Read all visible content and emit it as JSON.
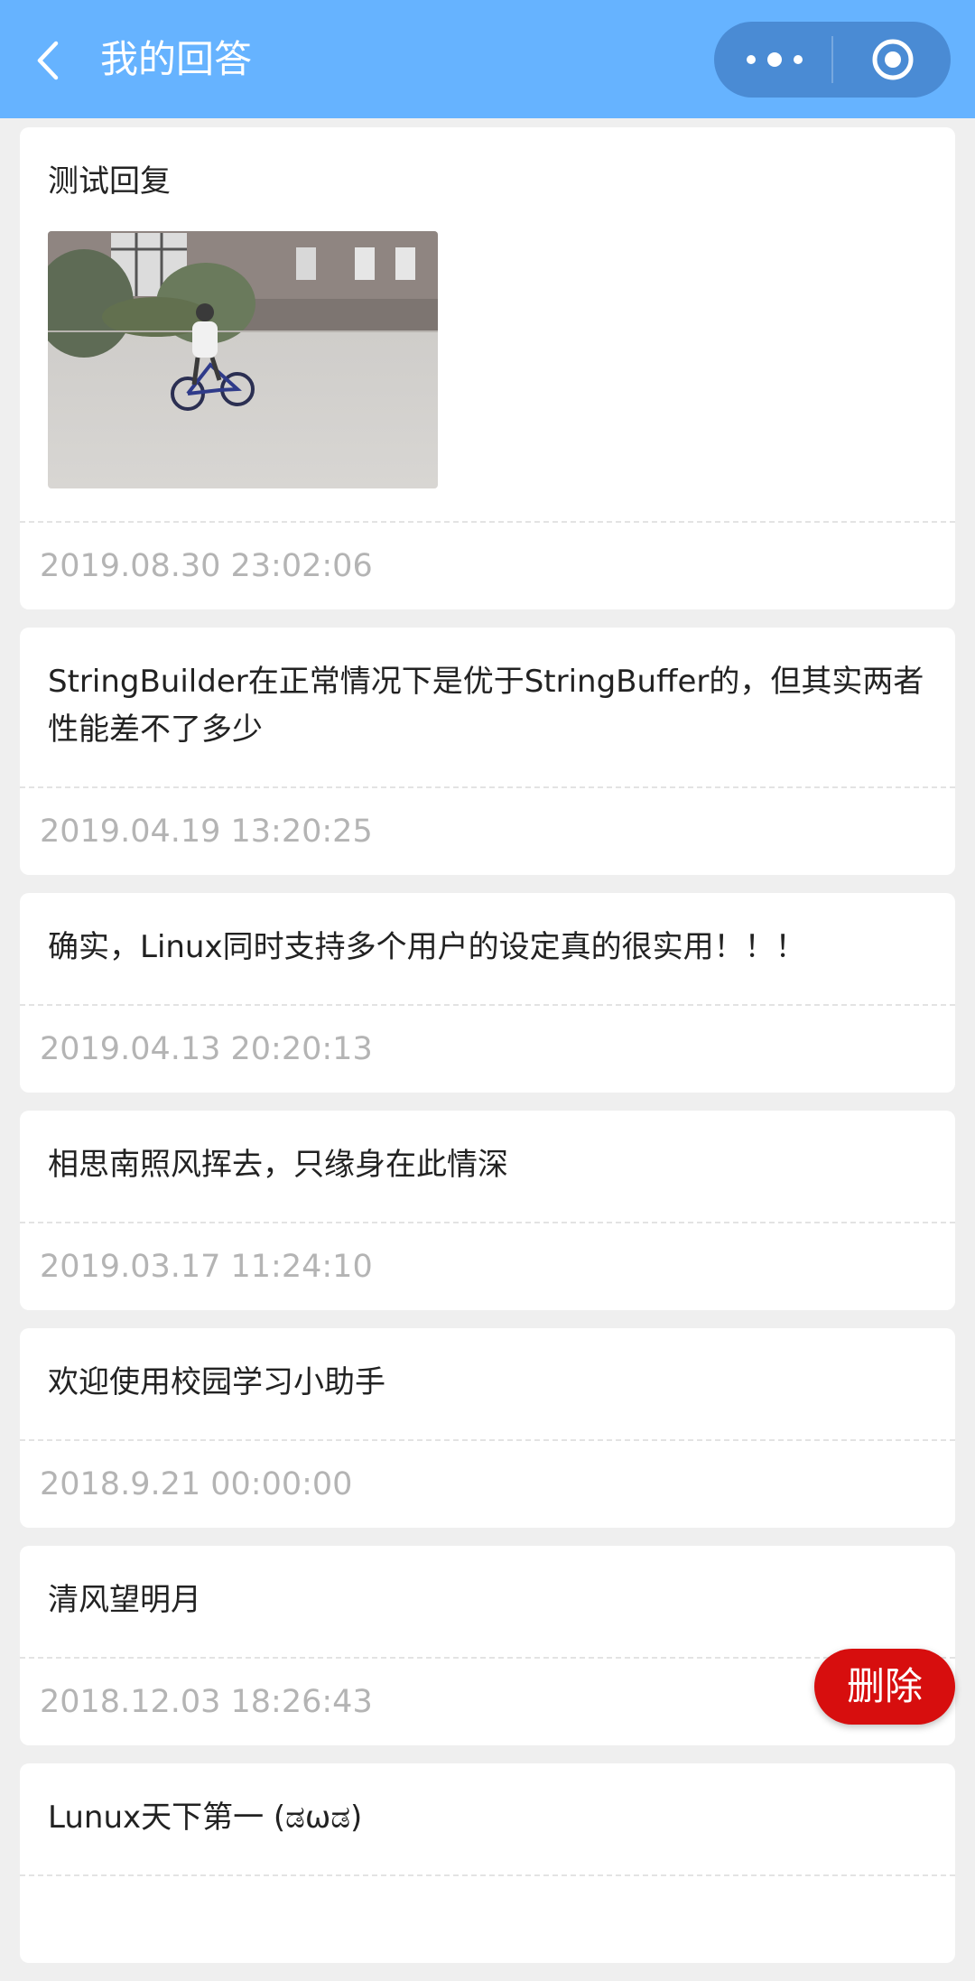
{
  "header": {
    "title": "我的回答",
    "back_icon": "chevron-left-icon",
    "more_icon": "more-dots-icon",
    "close_icon": "target-circle-icon",
    "color": "#66b3ff"
  },
  "answers": [
    {
      "content": "测试回复",
      "has_image": true,
      "time": "2019.08.30 23:02:06"
    },
    {
      "content": "StringBuilder在正常情况下是优于StringBuffer的，但其实两者性能差不了多少",
      "time": "2019.04.19 13:20:25"
    },
    {
      "content": "确实，Linux同时支持多个用户的设定真的很实用！！！",
      "time": "2019.04.13 20:20:13"
    },
    {
      "content": "相思南照风挥去，只缘身在此情深",
      "time": "2019.03.17 11:24:10"
    },
    {
      "content": "欢迎使用校园学习小助手",
      "time": "2018.9.21 00:00:00"
    },
    {
      "content": "清风望明月",
      "time": "2018.12.03 18:26:43"
    },
    {
      "content": "Lunux天下第一 (ಡωಡ)",
      "time": ""
    }
  ],
  "delete_button": {
    "label": "删除",
    "color": "#d70e0e"
  }
}
